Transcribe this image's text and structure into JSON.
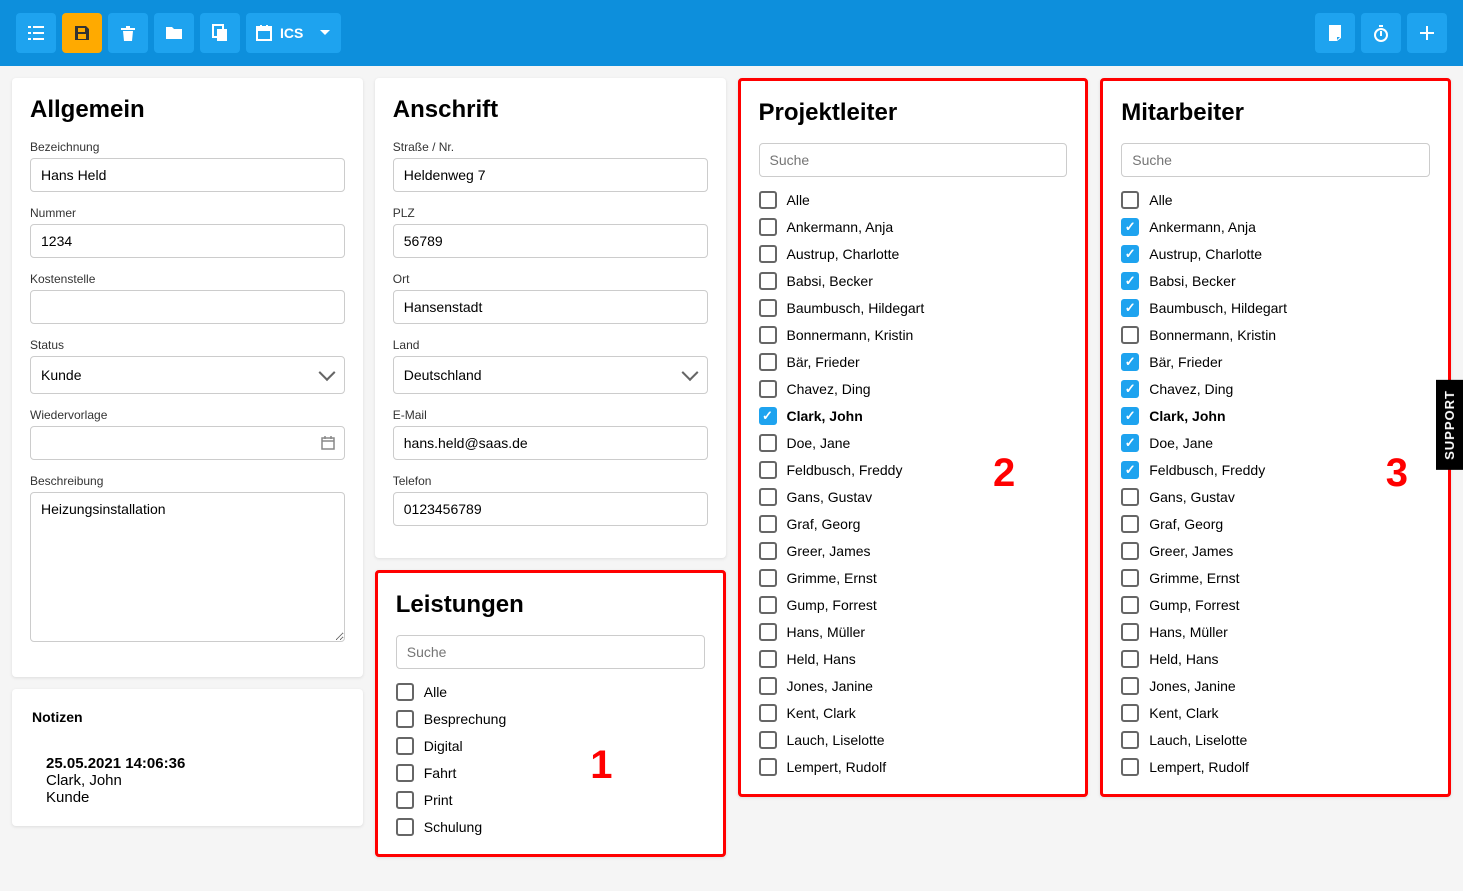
{
  "topbar": {
    "ics_label": "ICS"
  },
  "allgemein": {
    "title": "Allgemein",
    "bezeichnung_label": "Bezeichnung",
    "bezeichnung_value": "Hans Held",
    "nummer_label": "Nummer",
    "nummer_value": "1234",
    "kostenstelle_label": "Kostenstelle",
    "kostenstelle_value": "",
    "status_label": "Status",
    "status_value": "Kunde",
    "wiedervorlage_label": "Wiedervorlage",
    "wiedervorlage_value": "",
    "beschreibung_label": "Beschreibung",
    "beschreibung_value": "Heizungsinstallation"
  },
  "anschrift": {
    "title": "Anschrift",
    "strasse_label": "Straße / Nr.",
    "strasse_value": "Heldenweg 7",
    "plz_label": "PLZ",
    "plz_value": "56789",
    "ort_label": "Ort",
    "ort_value": "Hansenstadt",
    "land_label": "Land",
    "land_value": "Deutschland",
    "email_label": "E-Mail",
    "email_value": "hans.held@saas.de",
    "telefon_label": "Telefon",
    "telefon_value": "0123456789"
  },
  "leistungen": {
    "title": "Leistungen",
    "search_placeholder": "Suche",
    "items": [
      {
        "label": "Alle",
        "checked": false
      },
      {
        "label": "Besprechung",
        "checked": false
      },
      {
        "label": "Digital",
        "checked": false
      },
      {
        "label": "Fahrt",
        "checked": false
      },
      {
        "label": "Print",
        "checked": false
      },
      {
        "label": "Schulung",
        "checked": false
      }
    ],
    "number": "1"
  },
  "projektleiter": {
    "title": "Projektleiter",
    "search_placeholder": "Suche",
    "items": [
      {
        "label": "Alle",
        "checked": false,
        "bold": false
      },
      {
        "label": "Ankermann, Anja",
        "checked": false,
        "bold": false
      },
      {
        "label": "Austrup, Charlotte",
        "checked": false,
        "bold": false
      },
      {
        "label": "Babsi, Becker",
        "checked": false,
        "bold": false
      },
      {
        "label": "Baumbusch, Hildegart",
        "checked": false,
        "bold": false
      },
      {
        "label": "Bonnermann, Kristin",
        "checked": false,
        "bold": false
      },
      {
        "label": "Bär, Frieder",
        "checked": false,
        "bold": false
      },
      {
        "label": "Chavez, Ding",
        "checked": false,
        "bold": false
      },
      {
        "label": "Clark, John",
        "checked": true,
        "bold": true
      },
      {
        "label": "Doe, Jane",
        "checked": false,
        "bold": false
      },
      {
        "label": "Feldbusch, Freddy",
        "checked": false,
        "bold": false
      },
      {
        "label": "Gans, Gustav",
        "checked": false,
        "bold": false
      },
      {
        "label": "Graf, Georg",
        "checked": false,
        "bold": false
      },
      {
        "label": "Greer, James",
        "checked": false,
        "bold": false
      },
      {
        "label": "Grimme, Ernst",
        "checked": false,
        "bold": false
      },
      {
        "label": "Gump, Forrest",
        "checked": false,
        "bold": false
      },
      {
        "label": "Hans, Müller",
        "checked": false,
        "bold": false
      },
      {
        "label": "Held, Hans",
        "checked": false,
        "bold": false
      },
      {
        "label": "Jones, Janine",
        "checked": false,
        "bold": false
      },
      {
        "label": "Kent, Clark",
        "checked": false,
        "bold": false
      },
      {
        "label": "Lauch, Liselotte",
        "checked": false,
        "bold": false
      },
      {
        "label": "Lempert, Rudolf",
        "checked": false,
        "bold": false
      }
    ],
    "number": "2"
  },
  "mitarbeiter": {
    "title": "Mitarbeiter",
    "search_placeholder": "Suche",
    "items": [
      {
        "label": "Alle",
        "checked": false,
        "bold": false
      },
      {
        "label": "Ankermann, Anja",
        "checked": true,
        "bold": false
      },
      {
        "label": "Austrup, Charlotte",
        "checked": true,
        "bold": false
      },
      {
        "label": "Babsi, Becker",
        "checked": true,
        "bold": false
      },
      {
        "label": "Baumbusch, Hildegart",
        "checked": true,
        "bold": false
      },
      {
        "label": "Bonnermann, Kristin",
        "checked": false,
        "bold": false
      },
      {
        "label": "Bär, Frieder",
        "checked": true,
        "bold": false
      },
      {
        "label": "Chavez, Ding",
        "checked": true,
        "bold": false
      },
      {
        "label": "Clark, John",
        "checked": true,
        "bold": true
      },
      {
        "label": "Doe, Jane",
        "checked": true,
        "bold": false
      },
      {
        "label": "Feldbusch, Freddy",
        "checked": true,
        "bold": false
      },
      {
        "label": "Gans, Gustav",
        "checked": false,
        "bold": false
      },
      {
        "label": "Graf, Georg",
        "checked": false,
        "bold": false
      },
      {
        "label": "Greer, James",
        "checked": false,
        "bold": false
      },
      {
        "label": "Grimme, Ernst",
        "checked": false,
        "bold": false
      },
      {
        "label": "Gump, Forrest",
        "checked": false,
        "bold": false
      },
      {
        "label": "Hans, Müller",
        "checked": false,
        "bold": false
      },
      {
        "label": "Held, Hans",
        "checked": false,
        "bold": false
      },
      {
        "label": "Jones, Janine",
        "checked": false,
        "bold": false
      },
      {
        "label": "Kent, Clark",
        "checked": false,
        "bold": false
      },
      {
        "label": "Lauch, Liselotte",
        "checked": false,
        "bold": false
      },
      {
        "label": "Lempert, Rudolf",
        "checked": false,
        "bold": false
      }
    ],
    "number": "3"
  },
  "notizen": {
    "title": "Notizen",
    "date": "25.05.2021 14:06:36",
    "author": "Clark, John",
    "type": "Kunde"
  },
  "support_label": "SUPPORT"
}
